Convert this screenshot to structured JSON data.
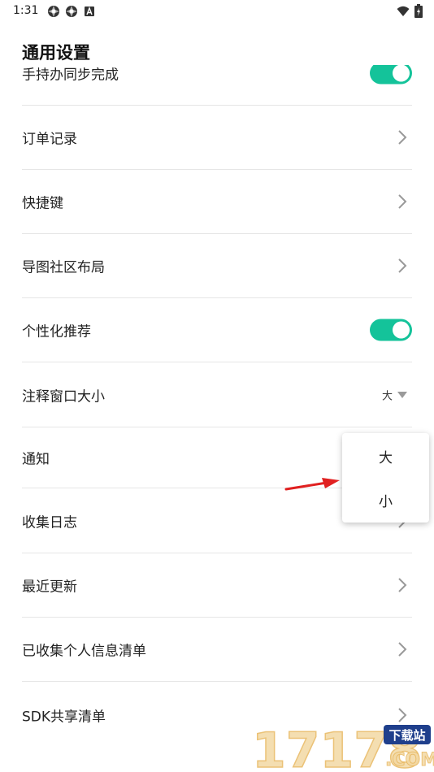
{
  "status_bar": {
    "time": "1:31",
    "left_icons": [
      "settings-icon",
      "settings-icon",
      "a-notification-icon"
    ],
    "right_icons": [
      "wifi-icon",
      "battery-charging-icon"
    ]
  },
  "page": {
    "title": "通用设置"
  },
  "settings": {
    "items": [
      {
        "label": "手持办同步完成",
        "control": "toggle",
        "state": "on"
      },
      {
        "label": "订单记录",
        "control": "chevron"
      },
      {
        "label": "快捷键",
        "control": "chevron"
      },
      {
        "label": "导图社区布局",
        "control": "chevron"
      },
      {
        "label": "个性化推荐",
        "control": "toggle",
        "state": "on"
      },
      {
        "label": "注释窗口大小",
        "control": "select",
        "value": "大"
      },
      {
        "label": "通知",
        "control": "none"
      },
      {
        "label": "收集日志",
        "control": "chevron"
      },
      {
        "label": "最近更新",
        "control": "chevron"
      },
      {
        "label": "已收集个人信息清单",
        "control": "chevron"
      },
      {
        "label": "SDK共享清单",
        "control": "chevron"
      }
    ]
  },
  "dropdown": {
    "options": [
      "大",
      "小"
    ]
  },
  "watermark": {
    "brand": "17178",
    "badge": "下载站",
    "domain": "COM"
  },
  "colors": {
    "accent": "#14c39a",
    "arrow": "#e02020",
    "divider": "#e6e6e6"
  }
}
